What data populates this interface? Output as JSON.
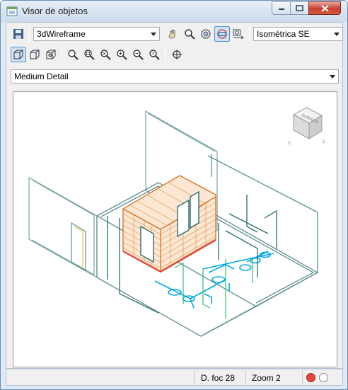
{
  "window": {
    "title": "Visor de objetos"
  },
  "toolbar1": {
    "visual_style": "3dWireframe",
    "view": "Isométrica SE"
  },
  "toolbar2": {
    "detail_level": "Medium Detail"
  },
  "viewcube": {
    "face_label": "SUPERIOR",
    "left_label": "S",
    "right_label": "E"
  },
  "status": {
    "focal": "D. foc 28",
    "zoom": "Zoom 2"
  },
  "colors": {
    "accent": "#3b7bd0",
    "brick": "#e08a2a",
    "pipe": "#00a8e8",
    "wall": "#5f8f8f",
    "red_light": "#e2473a"
  }
}
